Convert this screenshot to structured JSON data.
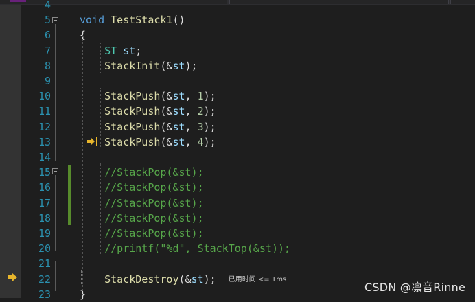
{
  "editor": {
    "lines": [
      {
        "n": "4",
        "tokens": []
      },
      {
        "n": "5",
        "tokens": [
          {
            "c": "kw",
            "t": "void"
          },
          {
            "c": "",
            "t": " "
          },
          {
            "c": "fn",
            "t": "TestStack1"
          },
          {
            "c": "",
            "t": "()"
          }
        ]
      },
      {
        "n": "6",
        "tokens": [
          {
            "c": "",
            "t": "{"
          }
        ]
      },
      {
        "n": "7",
        "tokens": [
          {
            "c": "",
            "t": "    "
          },
          {
            "c": "ty",
            "t": "ST"
          },
          {
            "c": "",
            "t": " "
          },
          {
            "c": "var",
            "t": "st"
          },
          {
            "c": "",
            "t": ";"
          }
        ]
      },
      {
        "n": "8",
        "tokens": [
          {
            "c": "",
            "t": "    "
          },
          {
            "c": "fn",
            "t": "StackInit"
          },
          {
            "c": "",
            "t": "(&"
          },
          {
            "c": "var",
            "t": "st"
          },
          {
            "c": "",
            "t": ");"
          }
        ]
      },
      {
        "n": "9",
        "tokens": []
      },
      {
        "n": "10",
        "tokens": [
          {
            "c": "",
            "t": "    "
          },
          {
            "c": "fn",
            "t": "StackPush"
          },
          {
            "c": "",
            "t": "(&"
          },
          {
            "c": "var",
            "t": "st"
          },
          {
            "c": "",
            "t": ", "
          },
          {
            "c": "num",
            "t": "1"
          },
          {
            "c": "",
            "t": ");"
          }
        ]
      },
      {
        "n": "11",
        "tokens": [
          {
            "c": "",
            "t": "    "
          },
          {
            "c": "fn",
            "t": "StackPush"
          },
          {
            "c": "",
            "t": "(&"
          },
          {
            "c": "var",
            "t": "st"
          },
          {
            "c": "",
            "t": ", "
          },
          {
            "c": "num",
            "t": "2"
          },
          {
            "c": "",
            "t": ");"
          }
        ]
      },
      {
        "n": "12",
        "tokens": [
          {
            "c": "",
            "t": "    "
          },
          {
            "c": "fn",
            "t": "StackPush"
          },
          {
            "c": "",
            "t": "(&"
          },
          {
            "c": "var",
            "t": "st"
          },
          {
            "c": "",
            "t": ", "
          },
          {
            "c": "num",
            "t": "3"
          },
          {
            "c": "",
            "t": ");"
          }
        ]
      },
      {
        "n": "13",
        "tokens": [
          {
            "c": "",
            "t": "    "
          },
          {
            "c": "fn",
            "t": "StackPush"
          },
          {
            "c": "",
            "t": "(&"
          },
          {
            "c": "var",
            "t": "st"
          },
          {
            "c": "",
            "t": ", "
          },
          {
            "c": "num",
            "t": "4"
          },
          {
            "c": "",
            "t": ");"
          }
        ]
      },
      {
        "n": "14",
        "tokens": []
      },
      {
        "n": "15",
        "tokens": [
          {
            "c": "",
            "t": "    "
          },
          {
            "c": "cm",
            "t": "//StackPop(&st);"
          }
        ]
      },
      {
        "n": "16",
        "tokens": [
          {
            "c": "",
            "t": "    "
          },
          {
            "c": "cm",
            "t": "//StackPop(&st);"
          }
        ]
      },
      {
        "n": "17",
        "tokens": [
          {
            "c": "",
            "t": "    "
          },
          {
            "c": "cm",
            "t": "//StackPop(&st);"
          }
        ]
      },
      {
        "n": "18",
        "tokens": [
          {
            "c": "",
            "t": "    "
          },
          {
            "c": "cm",
            "t": "//StackPop(&st);"
          }
        ]
      },
      {
        "n": "19",
        "tokens": [
          {
            "c": "",
            "t": "    "
          },
          {
            "c": "cm",
            "t": "//StackPop(&st);"
          }
        ]
      },
      {
        "n": "20",
        "tokens": [
          {
            "c": "",
            "t": "    "
          },
          {
            "c": "cm",
            "t": "//printf(\"%d\", StackTop(&st));"
          }
        ]
      },
      {
        "n": "21",
        "tokens": []
      },
      {
        "n": "22",
        "tokens": [
          {
            "c": "",
            "t": "    "
          },
          {
            "c": "fn",
            "t": "StackDestroy"
          },
          {
            "c": "",
            "t": "(&"
          },
          {
            "c": "var",
            "t": "st"
          },
          {
            "c": "",
            "t": ");"
          }
        ]
      },
      {
        "n": "23",
        "tokens": [
          {
            "c": "",
            "t": "}"
          }
        ]
      }
    ],
    "perf_tip": "已用时间 <= 1ms"
  },
  "icons": {
    "exec_arrow": "current-statement-arrow-icon",
    "step_marker": "step-into-marker-icon",
    "fold": "collapse-region-icon"
  },
  "colors": {
    "background": "#1e1e1e",
    "line_number": "#2b91af",
    "keyword": "#569cd6",
    "function": "#dcdcaa",
    "type": "#4ec9b0",
    "variable": "#9cdcfe",
    "number": "#b5cea8",
    "comment": "#57a64a",
    "change_bar": "#578b2c",
    "exec_arrow": "#e8b62c"
  },
  "watermark": "CSDN @凛音Rinne"
}
